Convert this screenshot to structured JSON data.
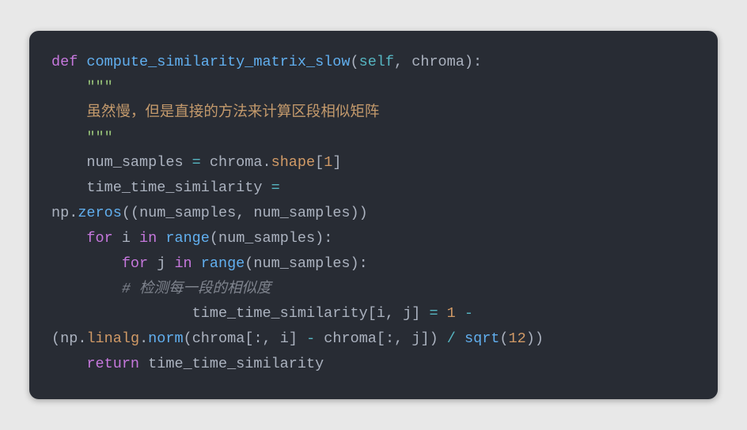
{
  "code": {
    "kw_def": "def",
    "func_name": "compute_similarity_matrix_slow",
    "lparen": "(",
    "self": "self",
    "comma_sp": ", ",
    "param_chroma": "chroma",
    "rparen": ")",
    "colon": ":",
    "triple_q": "\"\"\"",
    "doc_cn": "虽然慢，但是直接的方法来计算区段相似矩阵",
    "var_num_samples": "num_samples",
    "eq": " = ",
    "chroma": "chroma",
    "dot": ".",
    "shape": "shape",
    "lbrack": "[",
    "one": "1",
    "rbrack": "]",
    "var_tts": "time_time_similarity",
    "np": "np",
    "zeros": "zeros",
    "comma_inner": ", ",
    "dbl_lparen": "((",
    "dbl_rparen": "))",
    "kw_for": "for",
    "var_i": " i ",
    "kw_in": "in",
    "sp_range": " range",
    "var_j": " j ",
    "comment_hash": "# ",
    "comment_cn": "检测每一段的相似度",
    "idx_i": "i",
    "idx_j": "j",
    "eq2": " = ",
    "num_1b": "1",
    "minus": " - ",
    "linalg": "linalg",
    "norm": "norm",
    "slice_colon": ":",
    "minus_op": " - ",
    "div": " / ",
    "sqrt": "sqrt",
    "twelve": "12",
    "kw_return": "return",
    "sp": " ",
    "indent1": "    ",
    "indent2": "        ",
    "indent3": "            ",
    "indent_tts_assign": "                ",
    "wrap_prefix": "("
  }
}
